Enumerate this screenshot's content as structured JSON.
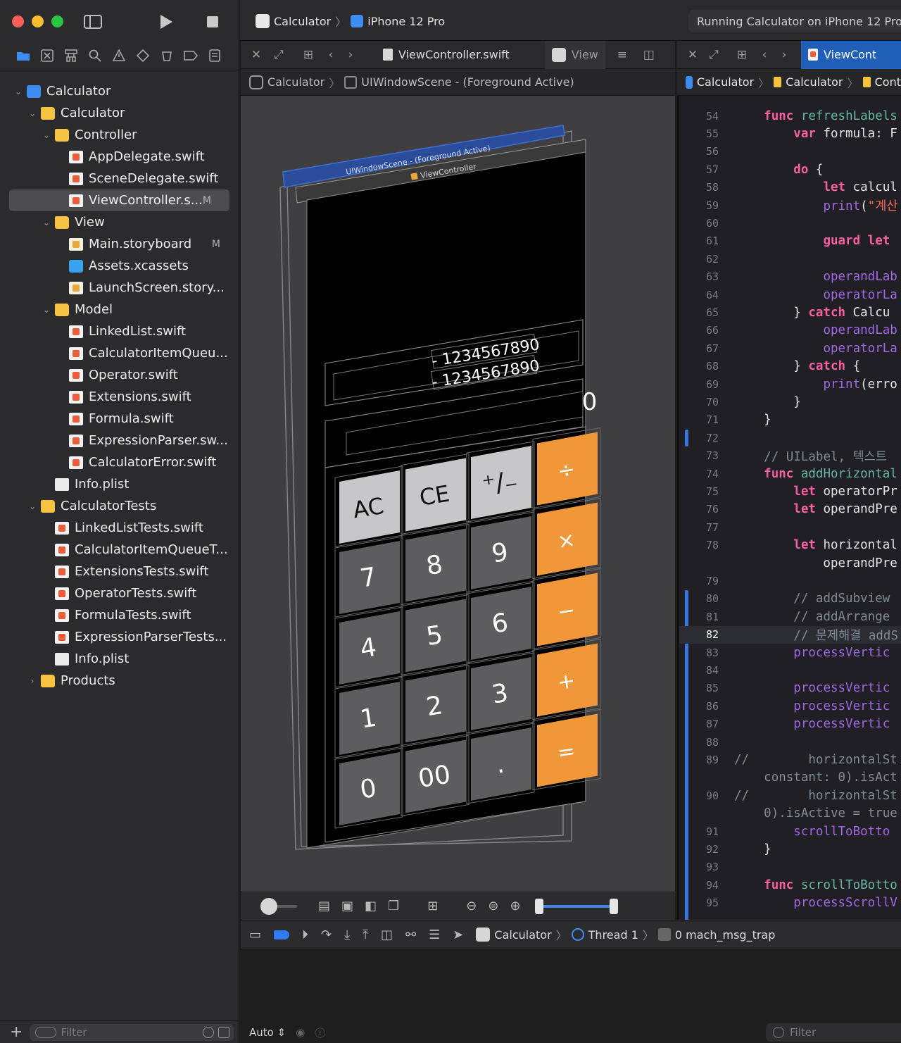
{
  "toolbar": {
    "scheme_target": "Calculator",
    "scheme_device": "iPhone 12 Pro",
    "activity_status": "Running Calculator on iPhone 12 Pro"
  },
  "navigator": {
    "tree": [
      {
        "label": "Calculator",
        "icon": "project-icon",
        "depth": 0,
        "disclosure": "open"
      },
      {
        "label": "Calculator",
        "icon": "folder-icon",
        "depth": 1,
        "disclosure": "open"
      },
      {
        "label": "Controller",
        "icon": "folder-icon",
        "depth": 2,
        "disclosure": "open"
      },
      {
        "label": "AppDelegate.swift",
        "icon": "swift-file-icon",
        "depth": 3
      },
      {
        "label": "SceneDelegate.swift",
        "icon": "swift-file-icon",
        "depth": 3
      },
      {
        "label": "ViewController.s...",
        "icon": "swift-file-icon",
        "depth": 3,
        "badge": "M",
        "selected": true
      },
      {
        "label": "View",
        "icon": "folder-icon",
        "depth": 2,
        "disclosure": "open"
      },
      {
        "label": "Main.storyboard",
        "icon": "storyboard-icon",
        "depth": 3,
        "badge": "M"
      },
      {
        "label": "Assets.xcassets",
        "icon": "assets-icon",
        "depth": 3
      },
      {
        "label": "LaunchScreen.story...",
        "icon": "storyboard-icon",
        "depth": 3
      },
      {
        "label": "Model",
        "icon": "folder-icon",
        "depth": 2,
        "disclosure": "open"
      },
      {
        "label": "LinkedList.swift",
        "icon": "swift-file-icon",
        "depth": 3
      },
      {
        "label": "CalculatorItemQueu...",
        "icon": "swift-file-icon",
        "depth": 3
      },
      {
        "label": "Operator.swift",
        "icon": "swift-file-icon",
        "depth": 3
      },
      {
        "label": "Extensions.swift",
        "icon": "swift-file-icon",
        "depth": 3
      },
      {
        "label": "Formula.swift",
        "icon": "swift-file-icon",
        "depth": 3
      },
      {
        "label": "ExpressionParser.sw...",
        "icon": "swift-file-icon",
        "depth": 3
      },
      {
        "label": "CalculatorError.swift",
        "icon": "swift-file-icon",
        "depth": 3
      },
      {
        "label": "Info.plist",
        "icon": "plist-icon",
        "depth": 2
      },
      {
        "label": "CalculatorTests",
        "icon": "folder-icon",
        "depth": 1,
        "disclosure": "open"
      },
      {
        "label": "LinkedListTests.swift",
        "icon": "swift-file-icon",
        "depth": 2
      },
      {
        "label": "CalculatorItemQueueT...",
        "icon": "swift-file-icon",
        "depth": 2
      },
      {
        "label": "ExtensionsTests.swift",
        "icon": "swift-file-icon",
        "depth": 2
      },
      {
        "label": "OperatorTests.swift",
        "icon": "swift-file-icon",
        "depth": 2
      },
      {
        "label": "FormulaTests.swift",
        "icon": "swift-file-icon",
        "depth": 2
      },
      {
        "label": "ExpressionParserTests...",
        "icon": "swift-file-icon",
        "depth": 2
      },
      {
        "label": "Info.plist",
        "icon": "plist-icon",
        "depth": 2
      },
      {
        "label": "Products",
        "icon": "folder-icon",
        "depth": 1,
        "disclosure": "closed"
      }
    ],
    "filter_placeholder": "Filter"
  },
  "editor_left": {
    "tab_label": "ViewController.swift",
    "tab2_label": "View",
    "jump": [
      "Calculator",
      "UIWindowScene - (Foreground Active)"
    ]
  },
  "editor_right": {
    "tab_label": "ViewCont",
    "jump": [
      "Calculator",
      "Calculator",
      "Cont"
    ]
  },
  "view_debugger": {
    "layer_labels": [
      "UIWindowScene - (Foreground Active)",
      "ViewController"
    ],
    "display": {
      "history_1": "- 1234567890",
      "history_2": "- 1234567890",
      "current": "0"
    },
    "buttons": [
      [
        "AC",
        "CE",
        "⁺∕₋",
        "÷"
      ],
      [
        "7",
        "8",
        "9",
        "×"
      ],
      [
        "4",
        "5",
        "6",
        "−"
      ],
      [
        "1",
        "2",
        "3",
        "+"
      ],
      [
        "0",
        "00",
        ".",
        "="
      ]
    ],
    "colors": {
      "function": "#c7c7c9",
      "number": "#5d5d5f",
      "operator": "#f0973a",
      "screen": "#000000"
    }
  },
  "code": {
    "lines": [
      {
        "n": "54",
        "t": "    <span class='kw'>func</span> <span class='fn'>refreshLabels</span>"
      },
      {
        "n": "55",
        "t": "        <span class='kw'>var</span> formula: F"
      },
      {
        "n": "56",
        "t": ""
      },
      {
        "n": "57",
        "t": "        <span class='kw'>do</span> {"
      },
      {
        "n": "58",
        "t": "            <span class='kw'>let</span> calcul"
      },
      {
        "n": "59",
        "t": "            <span class='id'>print</span>(<span class='str'>\"계산</span>"
      },
      {
        "n": "60",
        "t": ""
      },
      {
        "n": "61",
        "t": "            <span class='kw'>guard</span> <span class='kw'>let</span>"
      },
      {
        "n": "62",
        "t": ""
      },
      {
        "n": "63",
        "t": "            <span class='id'>operandLab</span>"
      },
      {
        "n": "64",
        "t": "            <span class='id'>operatorLa</span>"
      },
      {
        "n": "65",
        "t": "        } <span class='kw'>catch</span> Calcu"
      },
      {
        "n": "66",
        "t": "            <span class='id'>operandLab</span>"
      },
      {
        "n": "67",
        "t": "            <span class='id'>operatorLa</span>"
      },
      {
        "n": "68",
        "t": "        } <span class='kw'>catch</span> {"
      },
      {
        "n": "69",
        "t": "            <span class='id'>print</span>(erro"
      },
      {
        "n": "70",
        "t": "        }"
      },
      {
        "n": "71",
        "t": "    }"
      },
      {
        "n": "72",
        "t": ""
      },
      {
        "n": "73",
        "t": "    <span class='cm'>// UILabel, 텍스트 </span>"
      },
      {
        "n": "74",
        "t": "    <span class='kw'>func</span> <span class='fn'>addHorizontal</span>"
      },
      {
        "n": "75",
        "t": "        <span class='kw'>let</span> operatorPr"
      },
      {
        "n": "76",
        "t": "        <span class='kw'>let</span> operandPre"
      },
      {
        "n": "77",
        "t": ""
      },
      {
        "n": "78",
        "t": "        <span class='kw'>let</span> horizontal"
      },
      {
        "n": "",
        "t": "            operandPre"
      },
      {
        "n": "79",
        "t": ""
      },
      {
        "n": "80",
        "t": "        <span class='cm'>// addSubview</span>"
      },
      {
        "n": "81",
        "t": "        <span class='cm'>// addArrange</span>"
      },
      {
        "n": "82",
        "t": "        <span class='cm'>// 문제해결 addS</span>"
      },
      {
        "n": "83",
        "t": "        <span class='id'>processVertic</span>"
      },
      {
        "n": "84",
        "t": ""
      },
      {
        "n": "85",
        "t": "        <span class='id'>processVertic</span>"
      },
      {
        "n": "86",
        "t": "        <span class='id'>processVertic</span>"
      },
      {
        "n": "87",
        "t": "        <span class='id'>processVertic</span>"
      },
      {
        "n": "88",
        "t": ""
      },
      {
        "n": "89",
        "t": "<span class='cm'>//        horizontalSt</span>"
      },
      {
        "n": "",
        "t": "    <span class='cm'>constant: 0).isAct</span>"
      },
      {
        "n": "90",
        "t": "<span class='cm'>//        horizontalSt</span>"
      },
      {
        "n": "",
        "t": "    <span class='cm'>0).isActive = true</span>"
      },
      {
        "n": "91",
        "t": "        <span class='id'>scrollToBotto</span>"
      },
      {
        "n": "92",
        "t": "    }"
      },
      {
        "n": "93",
        "t": ""
      },
      {
        "n": "94",
        "t": "    <span class='kw'>func</span> <span class='fn'>scrollToBotto</span>"
      },
      {
        "n": "95",
        "t": "        <span class='id'>processScrollV</span>"
      }
    ],
    "current_line": "82"
  },
  "debug_bar": {
    "app": "Calculator",
    "thread": "Thread 1",
    "frame": "0 mach_msg_trap"
  },
  "console": {
    "mode": "Auto",
    "filter_placeholder": "Filter"
  }
}
